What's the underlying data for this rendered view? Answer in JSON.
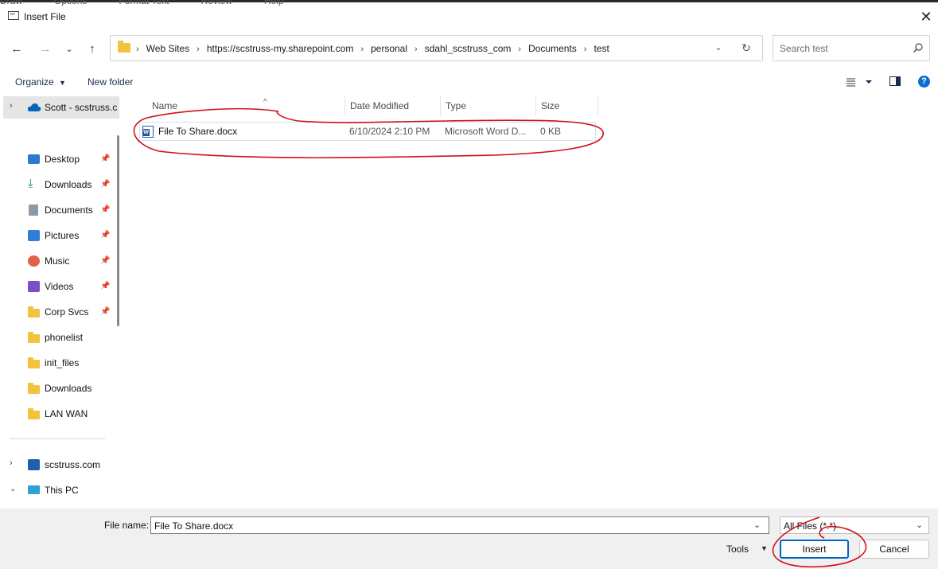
{
  "background_menu": [
    "Draw",
    "Options",
    "Format Text",
    "Review",
    "Help"
  ],
  "dialog": {
    "title": "Insert File"
  },
  "address": {
    "breadcrumbs": [
      "Web Sites",
      "https://scstruss-my.sharepoint.com",
      "personal",
      "sdahl_scstruss_com",
      "Documents",
      "test"
    ]
  },
  "search": {
    "placeholder": "Search test"
  },
  "toolbar": {
    "organize_label": "Organize",
    "new_folder_label": "New folder"
  },
  "sidebar": {
    "onedrive_label": "Scott - scstruss.c",
    "quick_access": [
      {
        "label": "Desktop",
        "icon": "desktop-icon",
        "pinned": true
      },
      {
        "label": "Downloads",
        "icon": "download-icon",
        "pinned": true
      },
      {
        "label": "Documents",
        "icon": "documents-icon",
        "pinned": true
      },
      {
        "label": "Pictures",
        "icon": "pictures-icon",
        "pinned": true
      },
      {
        "label": "Music",
        "icon": "music-icon",
        "pinned": true
      },
      {
        "label": "Videos",
        "icon": "videos-icon",
        "pinned": true
      },
      {
        "label": "Corp Svcs",
        "icon": "folder-icon",
        "pinned": true
      },
      {
        "label": "phonelist",
        "icon": "folder-icon",
        "pinned": false
      },
      {
        "label": "init_files",
        "icon": "folder-icon",
        "pinned": false
      },
      {
        "label": "Downloads",
        "icon": "folder-icon",
        "pinned": false
      },
      {
        "label": "LAN WAN",
        "icon": "folder-icon",
        "pinned": false
      }
    ],
    "sharepoint_label": "scstruss.com",
    "thispc_label": "This PC"
  },
  "columns": {
    "name": "Name",
    "date": "Date Modified",
    "type": "Type",
    "size": "Size"
  },
  "files": [
    {
      "name": "File To Share.docx",
      "date": "6/10/2024 2:10 PM",
      "type": "Microsoft Word D...",
      "size": "0 KB",
      "icon": "word-doc-icon"
    }
  ],
  "bottom": {
    "file_name_label": "File name:",
    "file_name_value": "File To Share.docx",
    "filter_value": "All Files (*.*)",
    "tools_label": "Tools",
    "insert_label": "Insert",
    "cancel_label": "Cancel"
  },
  "colors": {
    "accent": "#0067c0",
    "folder": "#f3c33d",
    "annotation": "#d0101a"
  }
}
